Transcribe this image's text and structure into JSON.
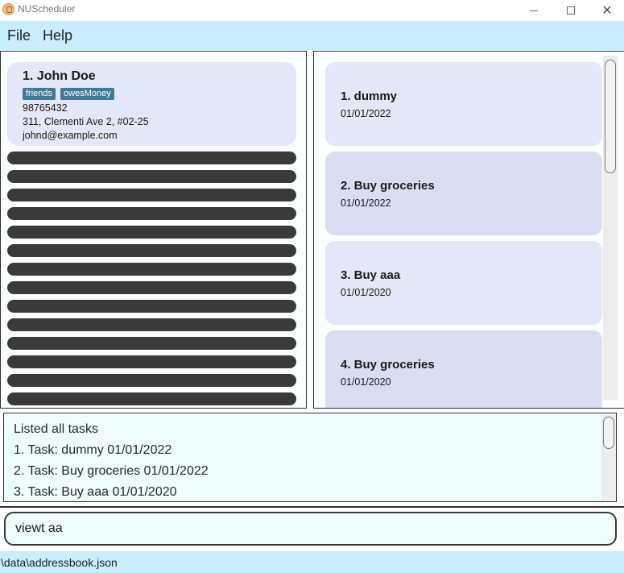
{
  "window": {
    "title": "NUScheduler"
  },
  "menu": {
    "file": "File",
    "help": "Help"
  },
  "person": {
    "name": "1.  John Doe",
    "tags": [
      "friends",
      "owesMoney"
    ],
    "phone": "98765432",
    "address": "311, Clementi Ave 2, #02-25",
    "email": "johnd@example.com"
  },
  "tasks": [
    {
      "title": "1.  dummy",
      "date": "01/01/2022"
    },
    {
      "title": "2.  Buy groceries",
      "date": "01/01/2022"
    },
    {
      "title": "3.  Buy aaa",
      "date": "01/01/2020"
    },
    {
      "title": "4.  Buy groceries",
      "date": "01/01/2020"
    }
  ],
  "result": {
    "lines": [
      "Listed all tasks",
      "1. Task: dummy 01/01/2022",
      "2. Task: Buy groceries 01/01/2022",
      "3. Task: Buy aaa 01/01/2020"
    ]
  },
  "command": {
    "value": "viewt aa"
  },
  "status": {
    "path": "\\data\\addressbook.json"
  },
  "colors": {
    "menu_bg": "#c9eefb",
    "card_bg": "#e4e7f5",
    "card_alt_bg": "#d9def1",
    "tag_bg": "#3f7a96",
    "empty_row": "#3a3a3a"
  }
}
